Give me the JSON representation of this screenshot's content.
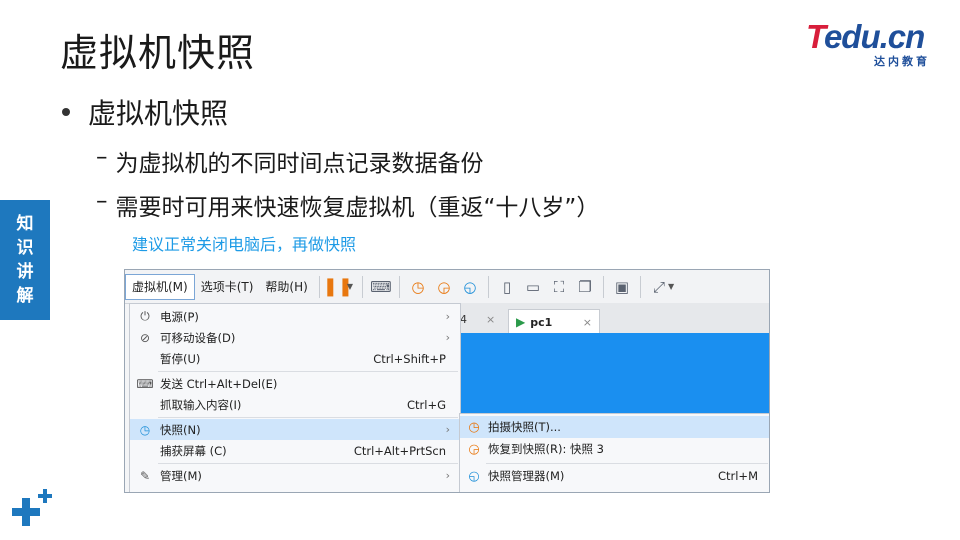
{
  "slide": {
    "title": "虚拟机快照",
    "bullet": "虚拟机快照",
    "sub1": "为虚拟机的不同时间点记录数据备份",
    "sub2": "需要时可用来快速恢复虚拟机（重返“十八岁”）",
    "dash": "–",
    "note": "建议正常关闭电脑后，再做快照",
    "side_tab": [
      "知",
      "识",
      "讲",
      "解"
    ]
  },
  "logo": {
    "t": "T",
    "rest": "edu.cn",
    "sub": "达内教育",
    "colors": {
      "red": "#d81e3b",
      "blue": "#1f4f9a"
    }
  },
  "menubar": {
    "items": [
      "虚拟机(M)",
      "选项卡(T)",
      "帮助(H)"
    ],
    "icons": [
      "pause-icon",
      "send-keys-icon",
      "snapshot-take-icon",
      "snapshot-revert-icon",
      "snapshot-manager-icon",
      "view-sidebar-icon",
      "view-console-icon",
      "fit-window-icon",
      "unity-icon",
      "terminal-icon",
      "fullscreen-icon"
    ]
  },
  "tabs": {
    "partial": "4",
    "close": "×",
    "active": "pc1"
  },
  "dropdown": {
    "items": [
      {
        "label": "电源(P)",
        "shortcut": "",
        "arrow": "›",
        "icon": "⏻"
      },
      {
        "label": "可移动设备(D)",
        "shortcut": "",
        "arrow": "›",
        "icon": "⊘"
      },
      {
        "label": "暂停(U)",
        "shortcut": "Ctrl+Shift+P",
        "arrow": "",
        "icon": ""
      },
      {
        "label": "发送 Ctrl+Alt+Del(E)",
        "shortcut": "",
        "arrow": "",
        "icon": "⌨"
      },
      {
        "label": "抓取输入内容(I)",
        "shortcut": "Ctrl+G",
        "arrow": "",
        "icon": ""
      },
      {
        "label": "快照(N)",
        "shortcut": "",
        "arrow": "›",
        "icon": "◷"
      },
      {
        "label": "捕获屏幕 (C)",
        "shortcut": "Ctrl+Alt+PrtScn",
        "arrow": "",
        "icon": ""
      },
      {
        "label": "管理(M)",
        "shortcut": "",
        "arrow": "›",
        "icon": "✎"
      }
    ]
  },
  "submenu": {
    "items": [
      {
        "label": "拍摄快照(T)...",
        "shortcut": "",
        "icon": "◷"
      },
      {
        "label": "恢复到快照(R): 快照 3",
        "shortcut": "",
        "icon": "◶"
      },
      {
        "label": "快照管理器(M)",
        "shortcut": "Ctrl+M",
        "icon": "◵"
      }
    ]
  }
}
